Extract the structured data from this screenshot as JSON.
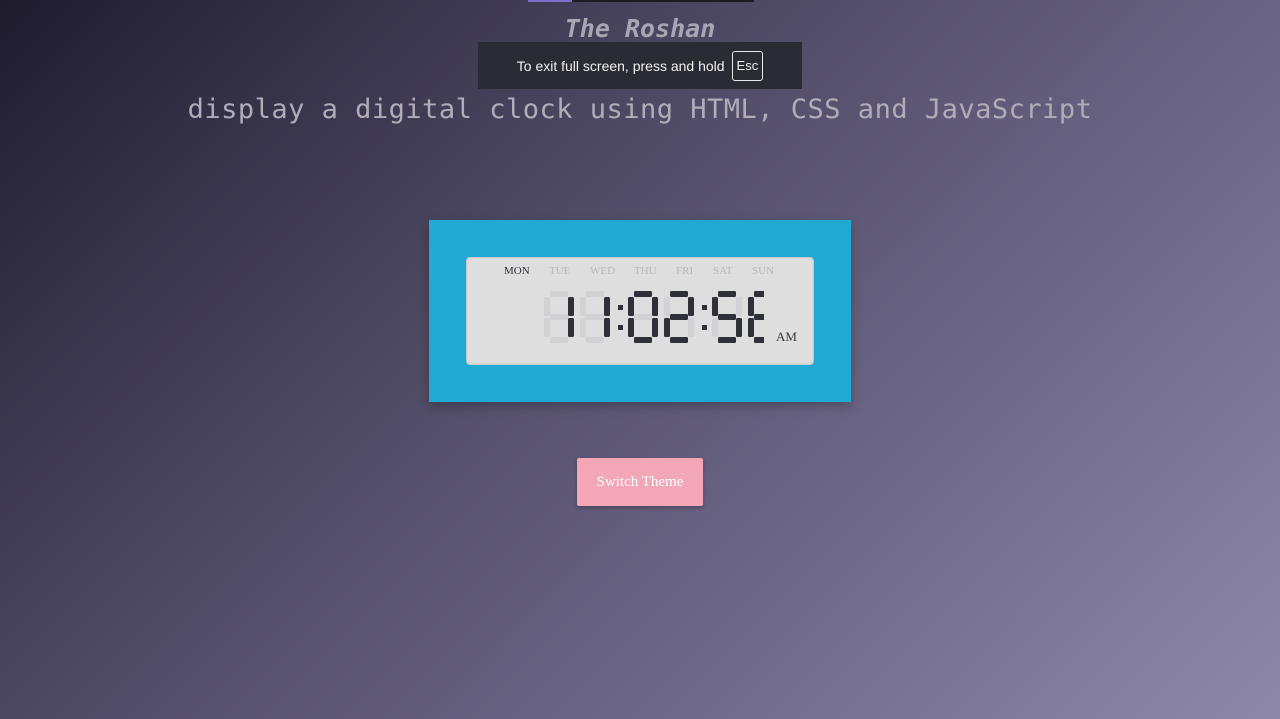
{
  "header": {
    "site_title": "The Roshan",
    "subtitle": "display a digital clock using HTML, CSS and JavaScript"
  },
  "fullscreen_toast": {
    "message": "To exit full screen, press and hold",
    "key_label": "Esc"
  },
  "clock": {
    "days": [
      "MON",
      "TUE",
      "WED",
      "THU",
      "FRI",
      "SAT",
      "SUN"
    ],
    "active_day": "MON",
    "time": "11:02:58",
    "period": "AM"
  },
  "controls": {
    "switch_theme_label": "Switch Theme"
  },
  "colors": {
    "clock_frame": "#1fa9d3",
    "clock_screen": "#dedede",
    "segment_on": "#2f3038",
    "segment_off": "#d2d2d4",
    "button": "#f2a6b6"
  }
}
